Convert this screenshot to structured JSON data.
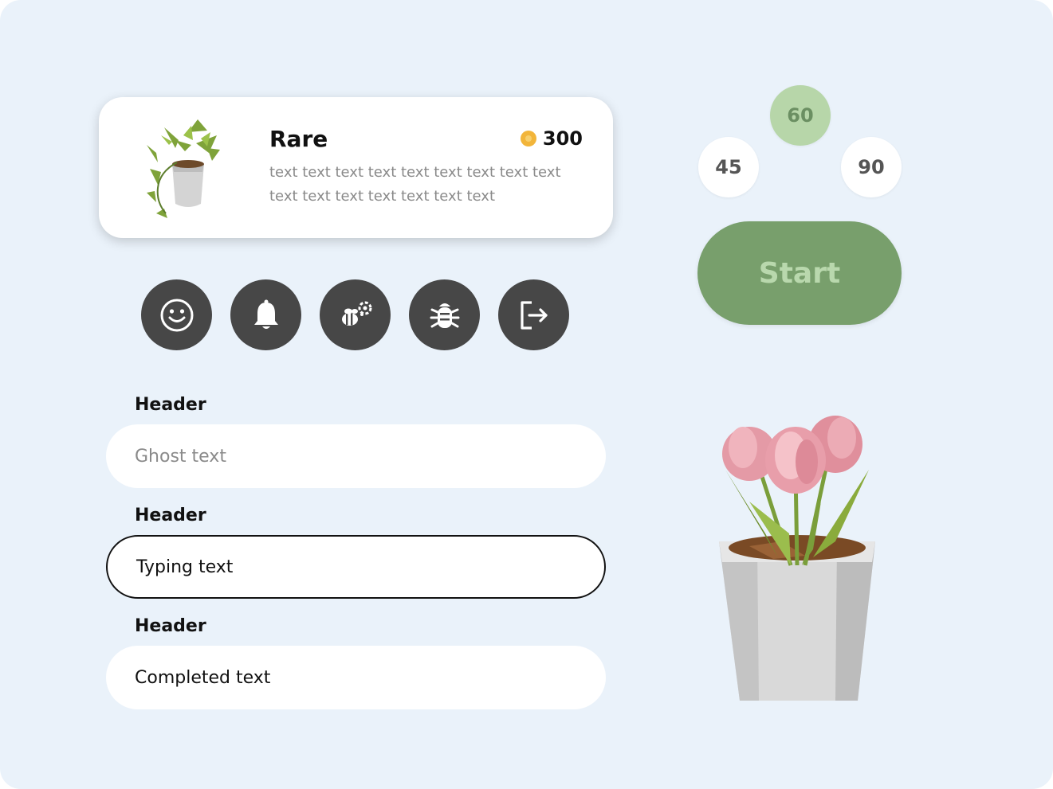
{
  "card": {
    "rarity": "Rare",
    "coins": "300",
    "description": "text text text text text text text text text text text text text text text text"
  },
  "icon_buttons": [
    {
      "icon": "smiley-icon"
    },
    {
      "icon": "bell-icon"
    },
    {
      "icon": "bee-flower-icon"
    },
    {
      "icon": "bug-icon"
    },
    {
      "icon": "logout-icon"
    }
  ],
  "form": {
    "fields": [
      {
        "header": "Header",
        "placeholder": "Ghost text",
        "value": ""
      },
      {
        "header": "Header",
        "value": "Typing text"
      },
      {
        "header": "Header",
        "value": "Completed text"
      }
    ]
  },
  "timer": {
    "options": [
      "45",
      "60",
      "90"
    ],
    "selected": "60",
    "start_label": "Start"
  },
  "colors": {
    "background": "#eaf2fa",
    "icon_button": "#474747",
    "start_button": "#789f6c",
    "selected_option": "#b7d6a9",
    "coin": "#f2b53a"
  }
}
